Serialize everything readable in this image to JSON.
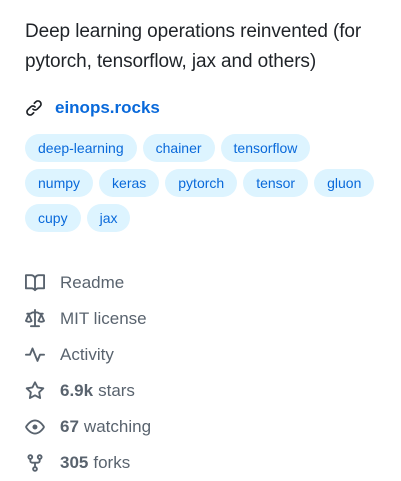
{
  "about": {
    "description": "Deep learning operations reinvented (for pytorch, tensorflow, jax and others)",
    "website": "einops.rocks",
    "topics": [
      "deep-learning",
      "chainer",
      "tensorflow",
      "numpy",
      "keras",
      "pytorch",
      "tensor",
      "gluon",
      "cupy",
      "jax"
    ]
  },
  "meta": {
    "readme": "Readme",
    "license": "MIT license",
    "activity": "Activity",
    "stars_count": "6.9k",
    "stars_label": "stars",
    "watching_count": "67",
    "watching_label": "watching",
    "forks_count": "305",
    "forks_label": "forks"
  },
  "icons": {
    "link": "link-icon",
    "readme": "book-icon",
    "license": "law-icon",
    "activity": "pulse-icon",
    "stars": "star-icon",
    "watching": "eye-icon",
    "forks": "repo-forked-icon"
  },
  "colors": {
    "link": "#0969da",
    "topic_bg": "#ddf4ff",
    "muted": "#59636e",
    "text": "#1f2328"
  }
}
